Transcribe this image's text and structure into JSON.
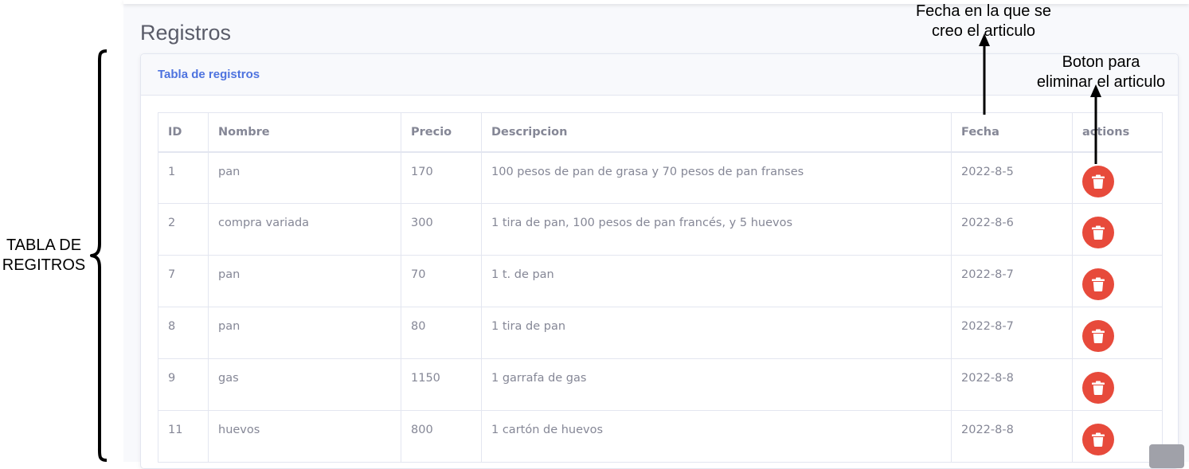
{
  "page": {
    "title": "Registros",
    "card_title": "Tabla de registros"
  },
  "table": {
    "columns": [
      "ID",
      "Nombre",
      "Precio",
      "Descripcion",
      "Fecha",
      "actions"
    ],
    "rows": [
      {
        "id": "1",
        "nombre": "pan",
        "precio": "170",
        "descripcion": "100 pesos de pan de grasa y 70 pesos de pan franses",
        "fecha": "2022-8-5"
      },
      {
        "id": "2",
        "nombre": "compra variada",
        "precio": "300",
        "descripcion": "1 tira de pan, 100 pesos de pan francés, y 5 huevos",
        "fecha": "2022-8-6"
      },
      {
        "id": "7",
        "nombre": "pan",
        "precio": "70",
        "descripcion": "1 t. de pan",
        "fecha": "2022-8-7"
      },
      {
        "id": "8",
        "nombre": "pan",
        "precio": "80",
        "descripcion": "1 tira de pan",
        "fecha": "2022-8-7"
      },
      {
        "id": "9",
        "nombre": "gas",
        "precio": "1150",
        "descripcion": "1 garrafa de gas",
        "fecha": "2022-8-8"
      },
      {
        "id": "11",
        "nombre": "huevos",
        "precio": "800",
        "descripcion": "1 cartón de huevos",
        "fecha": "2022-8-8"
      }
    ],
    "delete_icon": "trash-icon"
  },
  "annotations": {
    "table_label_line1": "TABLA DE",
    "table_label_line2": "REGITROS",
    "date_label_line1": "Fecha en la que se",
    "date_label_line2": "creo el articulo",
    "button_label_line1": "Boton para",
    "button_label_line2": "eliminar el articulo"
  },
  "colors": {
    "accent": "#4e73df",
    "danger": "#e74a3b",
    "text_muted": "#858796",
    "heading": "#5a5c69"
  }
}
